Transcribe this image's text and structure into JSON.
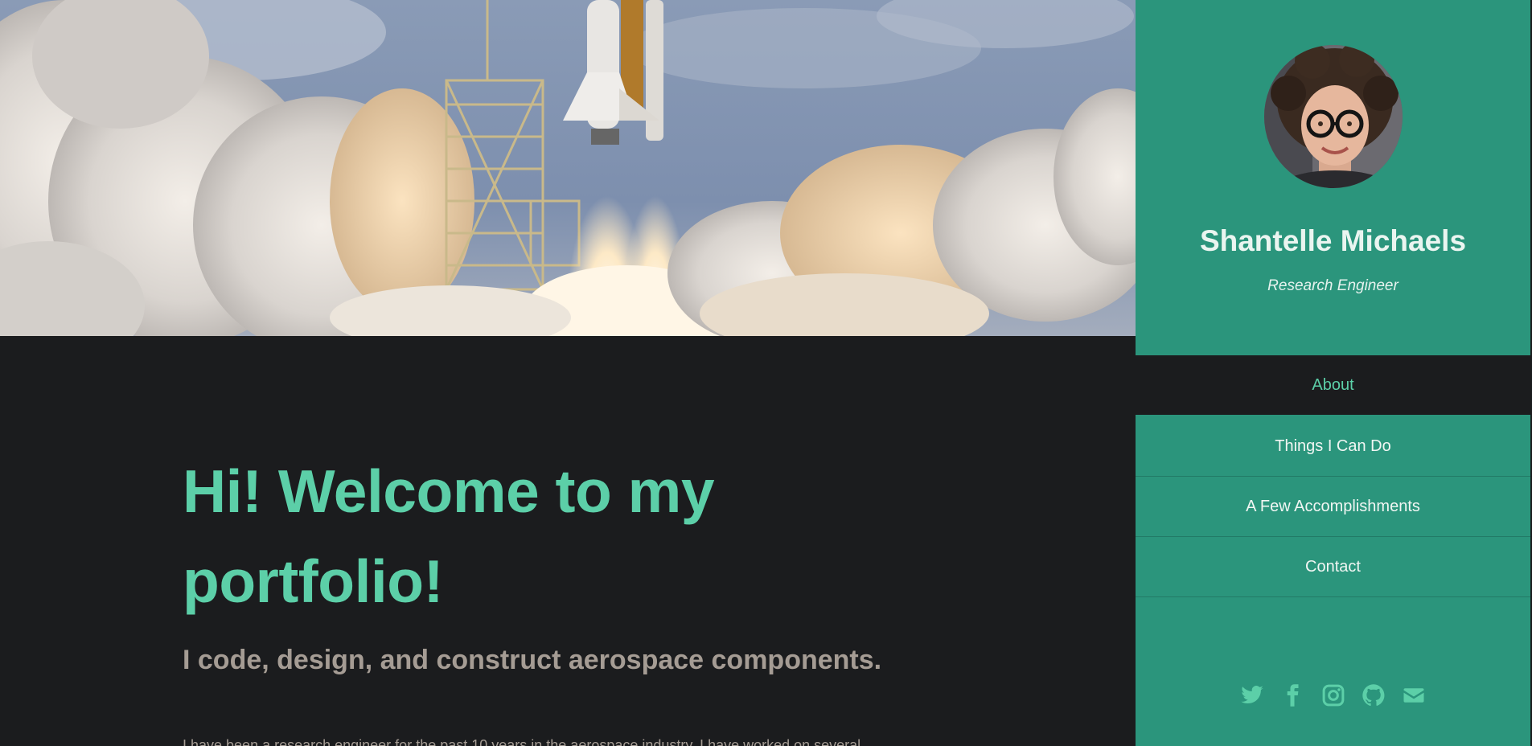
{
  "hero": {
    "image": "rocket-launch-photo"
  },
  "main": {
    "title": "Hi! Welcome to my portfolio!",
    "subtitle": "I code, design, and construct aerospace components.",
    "intro": "I have been a research engineer for the past 10 years in the aerospace industry. I have worked on several"
  },
  "profile": {
    "name": "Shantelle Michaels",
    "role": "Research Engineer",
    "avatar": "avatar-photo"
  },
  "nav": {
    "items": [
      {
        "label": "About",
        "active": true
      },
      {
        "label": "Things I Can Do",
        "active": false
      },
      {
        "label": "A Few Accomplishments",
        "active": false
      },
      {
        "label": "Contact",
        "active": false
      }
    ]
  },
  "socials": [
    {
      "icon": "twitter-icon"
    },
    {
      "icon": "facebook-icon"
    },
    {
      "icon": "instagram-icon"
    },
    {
      "icon": "github-icon"
    },
    {
      "icon": "email-icon"
    }
  ],
  "colors": {
    "accent": "#5ccfa8",
    "sidebar": "#2b957c",
    "background": "#1b1c1e",
    "muted_text": "#a59c94"
  }
}
